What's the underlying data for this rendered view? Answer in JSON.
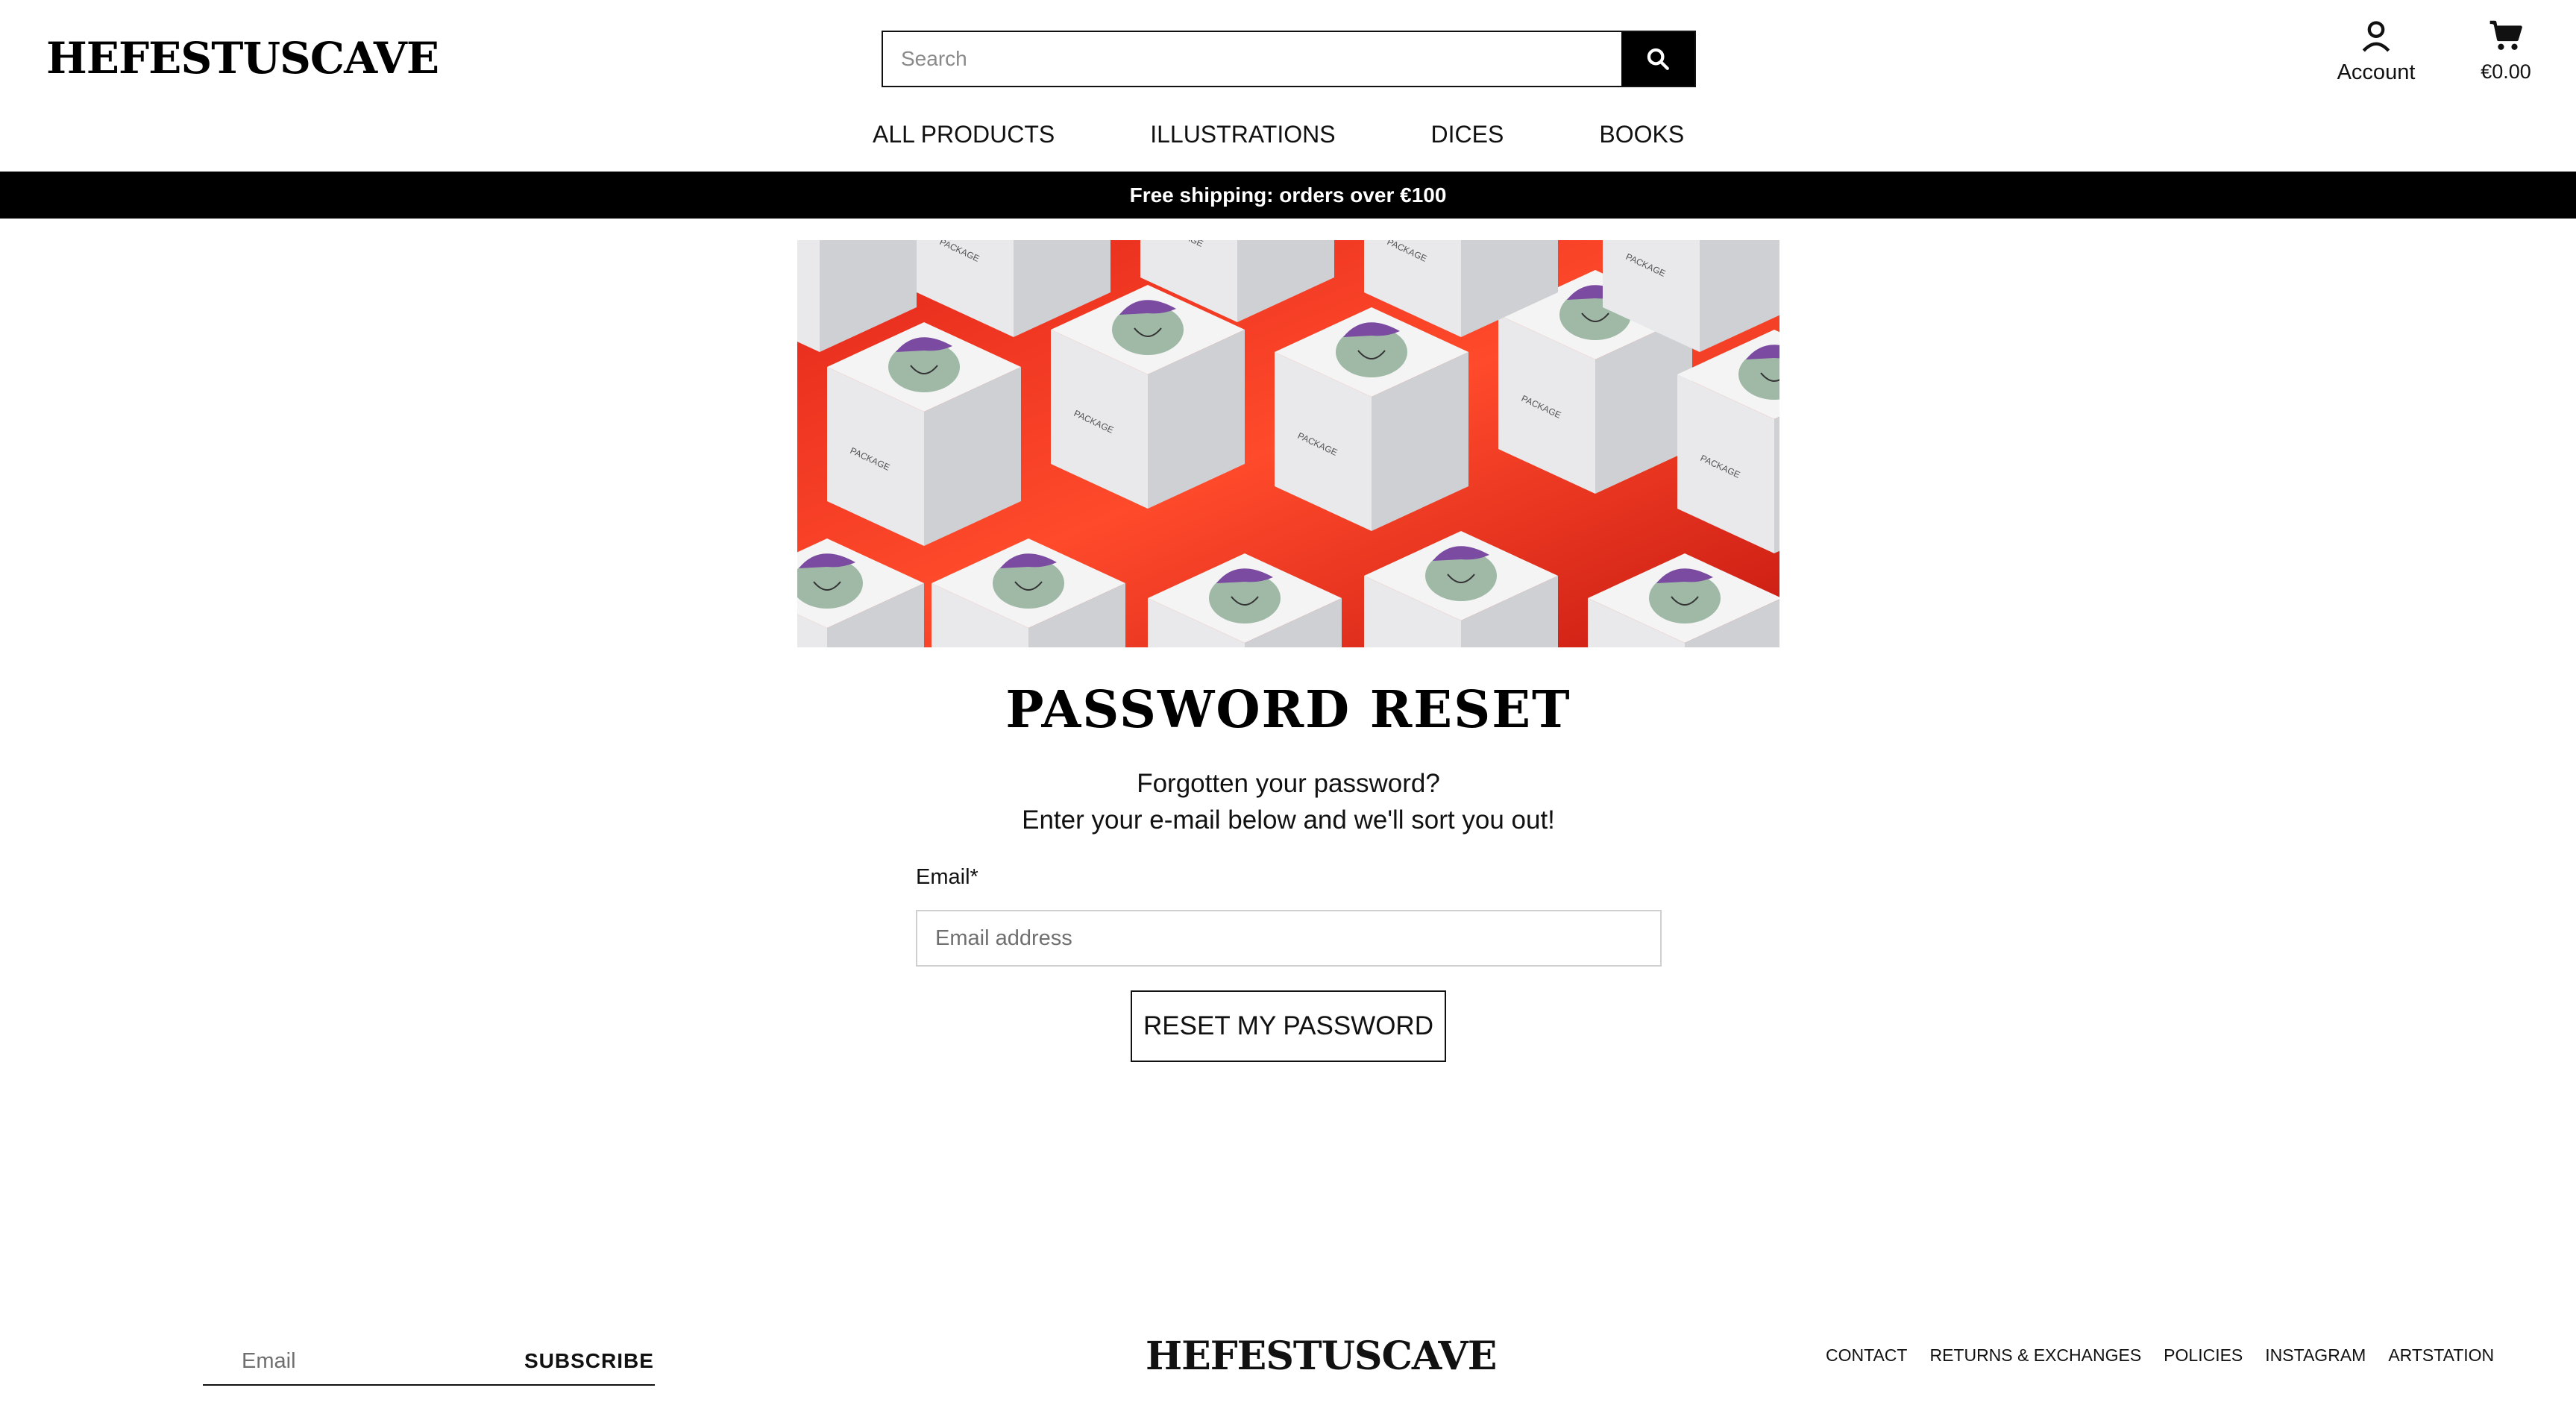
{
  "header": {
    "logo_text": "HEFESTUSCAVE",
    "search": {
      "placeholder": "Search",
      "value": "",
      "icon": "search-icon"
    },
    "account_label": "Account",
    "account_icon": "user-icon",
    "cart_amount": "€0.00",
    "cart_icon": "cart-icon"
  },
  "nav": {
    "items": [
      {
        "label": "ALL PRODUCTS"
      },
      {
        "label": "ILLUSTRATIONS"
      },
      {
        "label": "DICES"
      },
      {
        "label": "BOOKS"
      }
    ]
  },
  "banner": {
    "text": "Free shipping: orders over €100"
  },
  "hero": {
    "box_label": "PACKAGE"
  },
  "main": {
    "title": "PASSWORD RESET",
    "subtitle_line1": "Forgotten your password?",
    "subtitle_line2": "Enter your e-mail below and we'll sort you out!",
    "email_label": "Email*",
    "email_placeholder": "Email address",
    "email_value": "",
    "reset_button": "RESET MY PASSWORD"
  },
  "footer": {
    "email_placeholder": "Email",
    "subscribe_label": "SUBSCRIBE",
    "logo_text": "HEFESTUSCAVE",
    "links": [
      {
        "label": "CONTACT"
      },
      {
        "label": "RETURNS & EXCHANGES"
      },
      {
        "label": "POLICIES"
      },
      {
        "label": "INSTAGRAM"
      },
      {
        "label": "ARTSTATION"
      }
    ]
  },
  "colors": {
    "banner_bg": "#000000",
    "hero_bg": "#d9221a",
    "text": "#111111"
  }
}
